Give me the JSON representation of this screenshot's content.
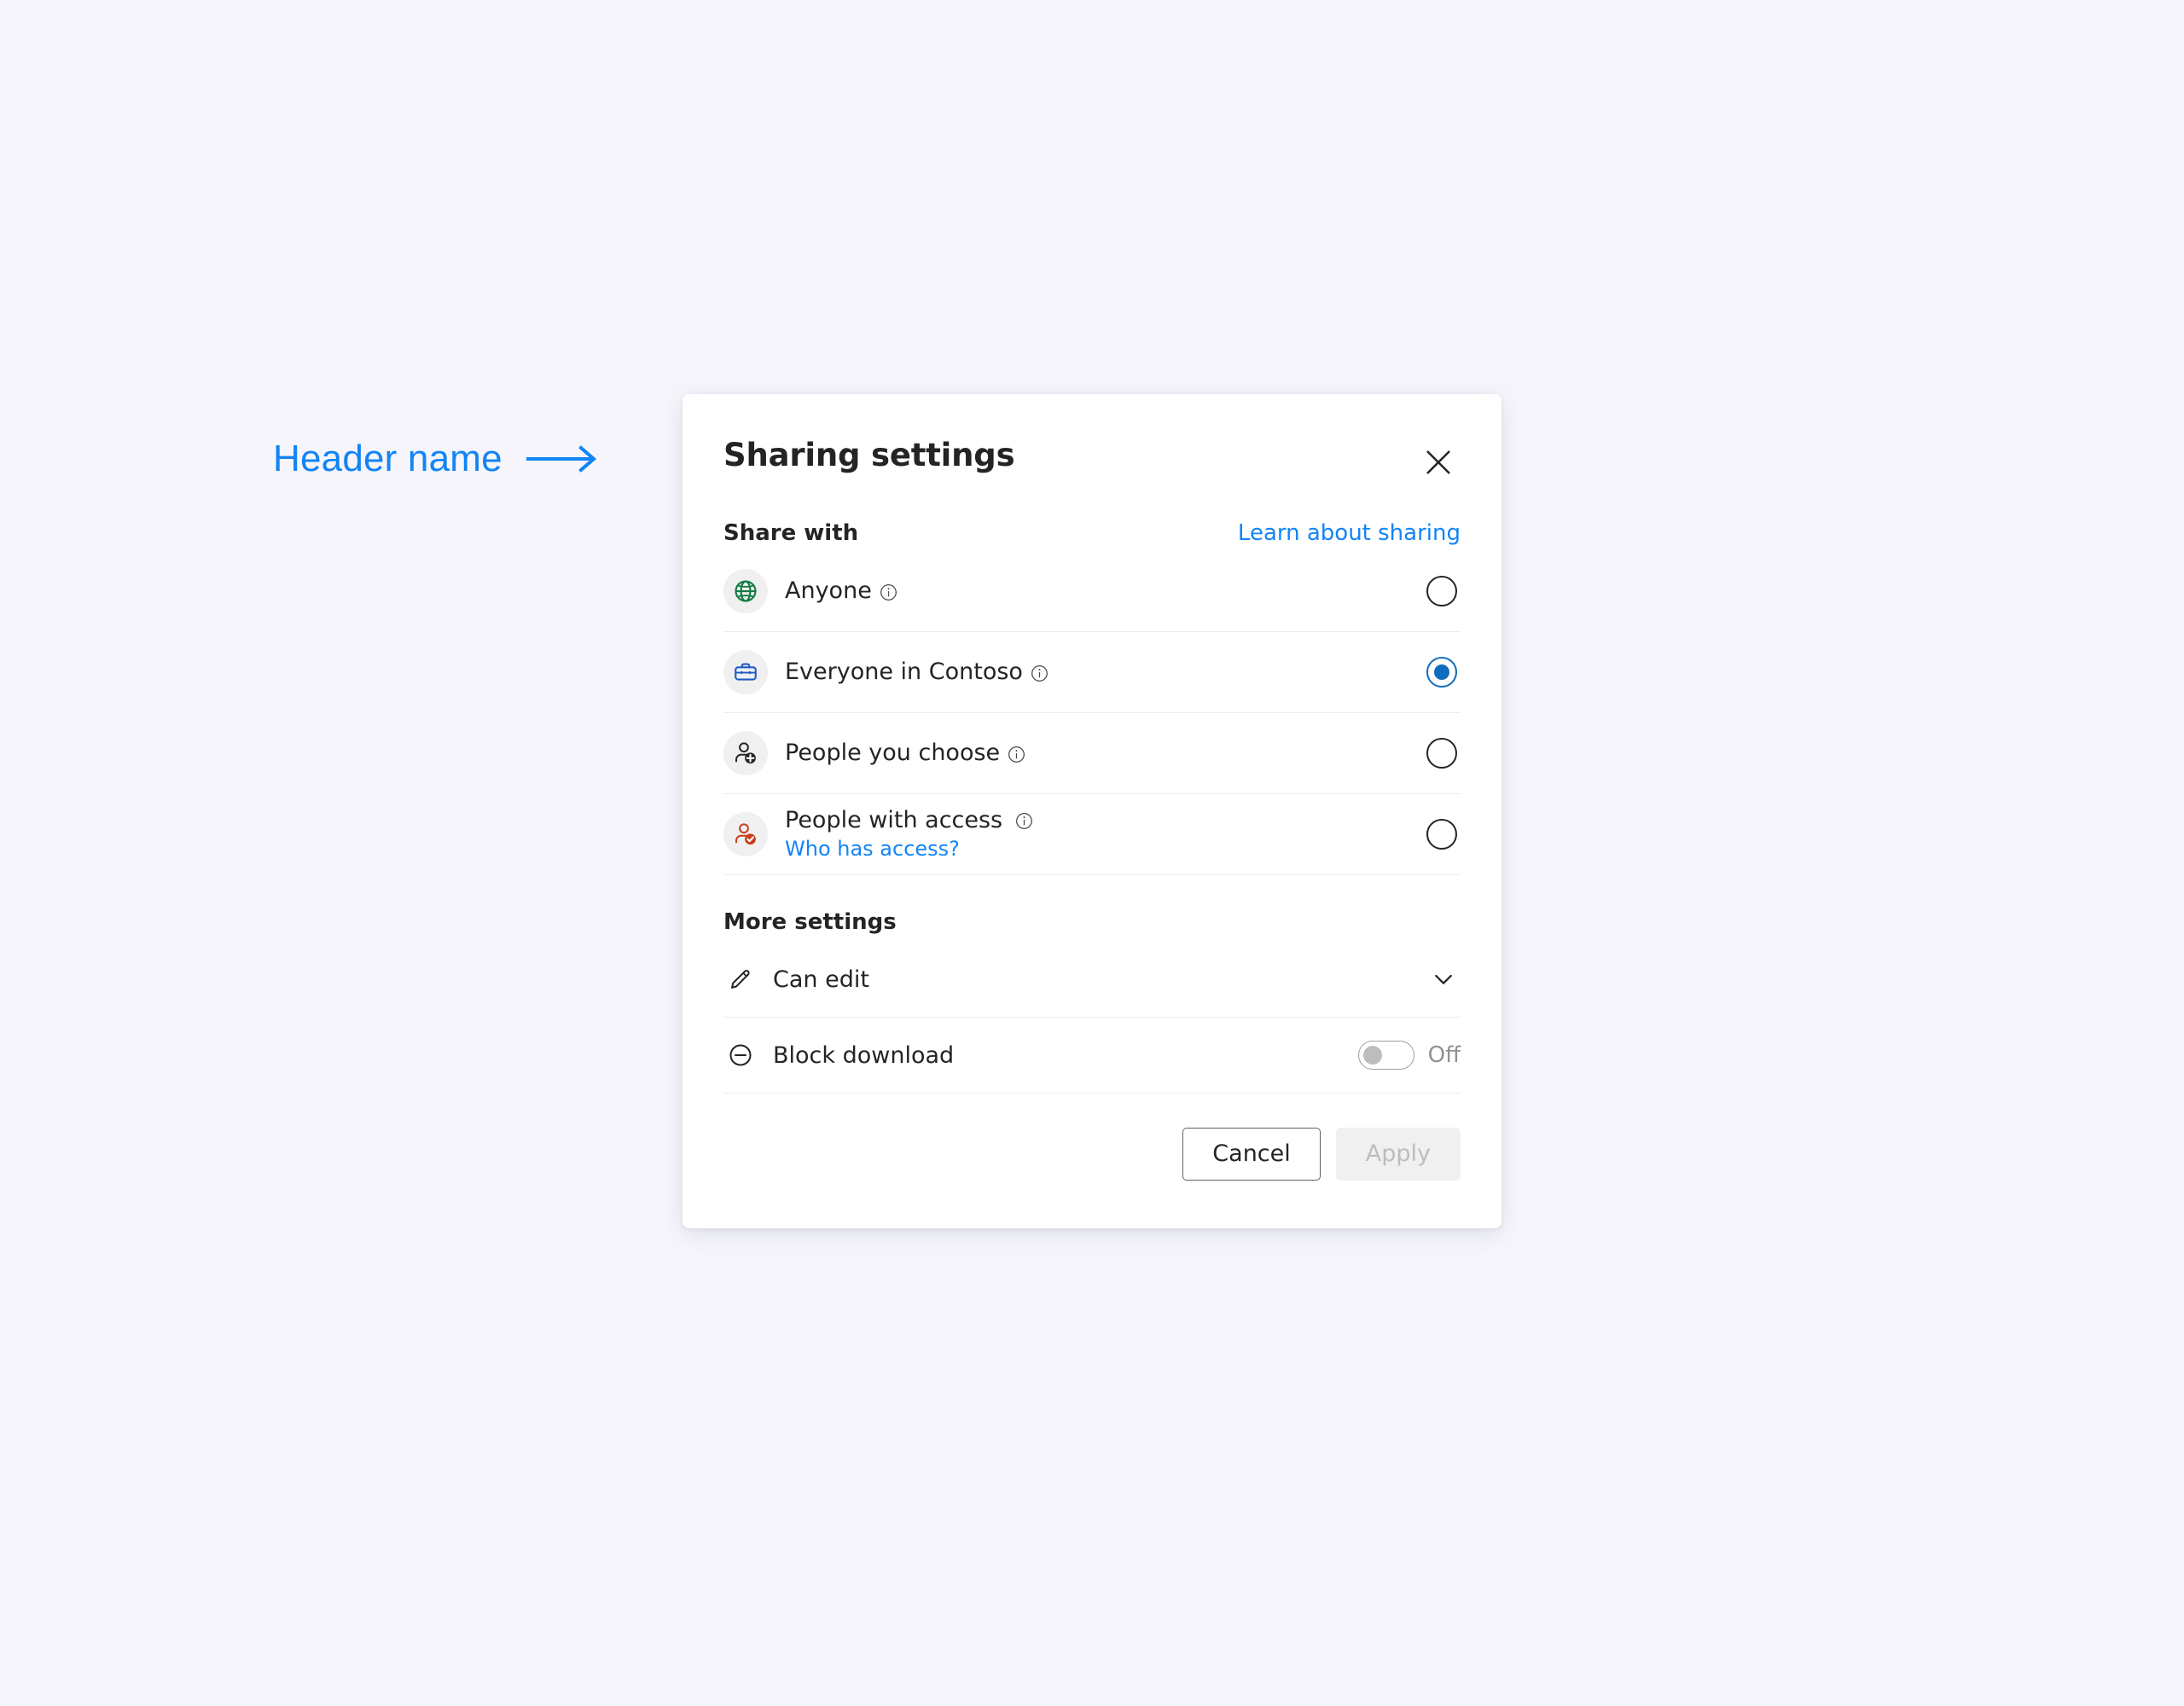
{
  "annotation": {
    "label": "Header name",
    "arrow_icon": "arrow-right-icon",
    "color": "#1284f7"
  },
  "dialog": {
    "title": "Sharing settings",
    "close_icon": "close-icon",
    "share_with": {
      "section_title": "Share with",
      "learn_link": "Learn about sharing",
      "options": [
        {
          "icon": "globe-icon",
          "icon_color": "#107c41",
          "label": "Anyone",
          "info_icon": "info-icon",
          "selected": false
        },
        {
          "icon": "briefcase-icon",
          "icon_color": "#1f5bc4",
          "label": "Everyone in Contoso",
          "info_icon": "info-icon",
          "selected": true
        },
        {
          "icon": "person-add-icon",
          "icon_color": "#242424",
          "label": "People you choose",
          "info_icon": "info-icon",
          "selected": false
        },
        {
          "icon": "person-check-icon",
          "icon_color": "#c73e1d",
          "label": "People with access",
          "info_icon": "info-icon",
          "sublink": "Who has access?",
          "selected": false
        }
      ]
    },
    "more_settings": {
      "section_title": "More settings",
      "permission": {
        "icon": "pencil-icon",
        "label": "Can edit",
        "chevron_icon": "chevron-down-icon"
      },
      "block_download": {
        "icon": "minus-circle-icon",
        "label": "Block download",
        "toggle_state": "Off",
        "toggle_on": false
      }
    },
    "footer": {
      "cancel_label": "Cancel",
      "apply_label": "Apply"
    },
    "accent_color": "#0f6cbd"
  }
}
